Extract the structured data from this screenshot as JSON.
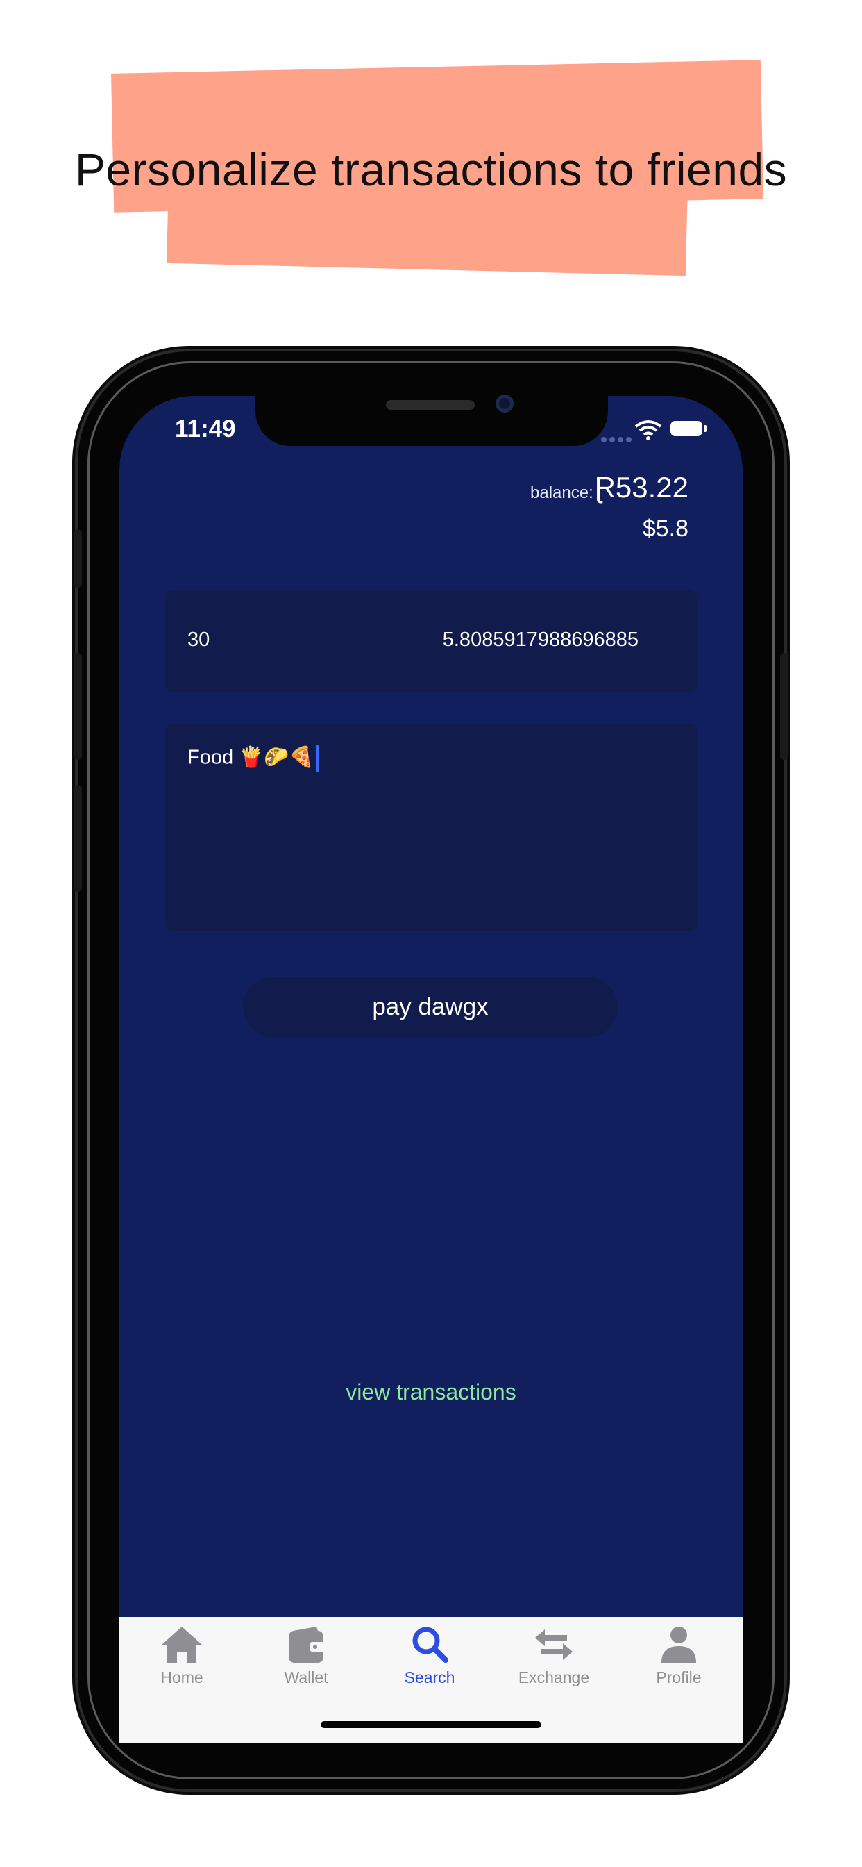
{
  "headline": "Personalize transactions to friends",
  "status_bar": {
    "time": "11:49"
  },
  "balance": {
    "label": "balance:",
    "value": "Ɽ53.22",
    "usd": "$5.8"
  },
  "amount": {
    "left": "30",
    "right": "5.8085917988696885"
  },
  "memo": {
    "text": "Food 🍟🌮🍕"
  },
  "pay_button": {
    "label": "pay dawgx"
  },
  "view_transactions": {
    "label": "view transactions"
  },
  "tabs": [
    {
      "label": "Home",
      "icon": "home-icon",
      "active": false
    },
    {
      "label": "Wallet",
      "icon": "wallet-icon",
      "active": false
    },
    {
      "label": "Search",
      "icon": "search-icon",
      "active": true
    },
    {
      "label": "Exchange",
      "icon": "exchange-icon",
      "active": false
    },
    {
      "label": "Profile",
      "icon": "profile-icon",
      "active": false
    }
  ],
  "colors": {
    "screen_bg": "#121f5e",
    "panel_bg": "#111c4d",
    "accent_link": "#8ee89a",
    "headline_highlight": "#ffa28a",
    "tab_active": "#2d4de0",
    "tab_inactive": "#8e8e93"
  }
}
